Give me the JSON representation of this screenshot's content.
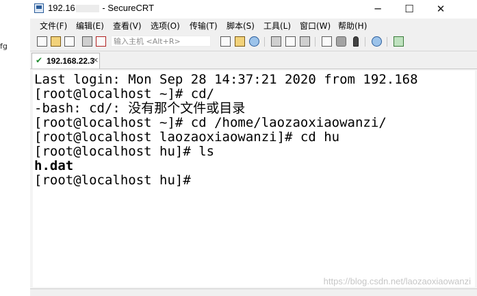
{
  "window": {
    "title_prefix": "192.16",
    "title_suffix": "- SecureCRT"
  },
  "left_panel": {
    "fragment": "fg"
  },
  "controls": {
    "minimize": "─",
    "maximize": "☐",
    "close": "✕"
  },
  "menu": [
    "文件(F)",
    "编辑(E)",
    "查看(V)",
    "选项(O)",
    "传输(T)",
    "脚本(S)",
    "工具(L)",
    "窗口(W)",
    "帮助(H)"
  ],
  "toolbar": {
    "quick_connect_placeholder": "输入主机 <Alt+R>"
  },
  "tab": {
    "label": "192.168.22.3",
    "check": "✔",
    "close": "×"
  },
  "terminal": {
    "lines": [
      "Last login: Mon Sep 28 14:37:21 2020 from 192.168",
      "[root@localhost ~]# cd/",
      "-bash: cd/: 没有那个文件或目录",
      "[root@localhost ~]# cd /home/laozaoxiaowanzi/",
      "[root@localhost laozaoxiaowanzi]# cd hu",
      "[root@localhost hu]# ls",
      "h.dat",
      "[root@localhost hu]#"
    ]
  },
  "watermark": "https://blog.csdn.net/laozaoxiaowanzi"
}
